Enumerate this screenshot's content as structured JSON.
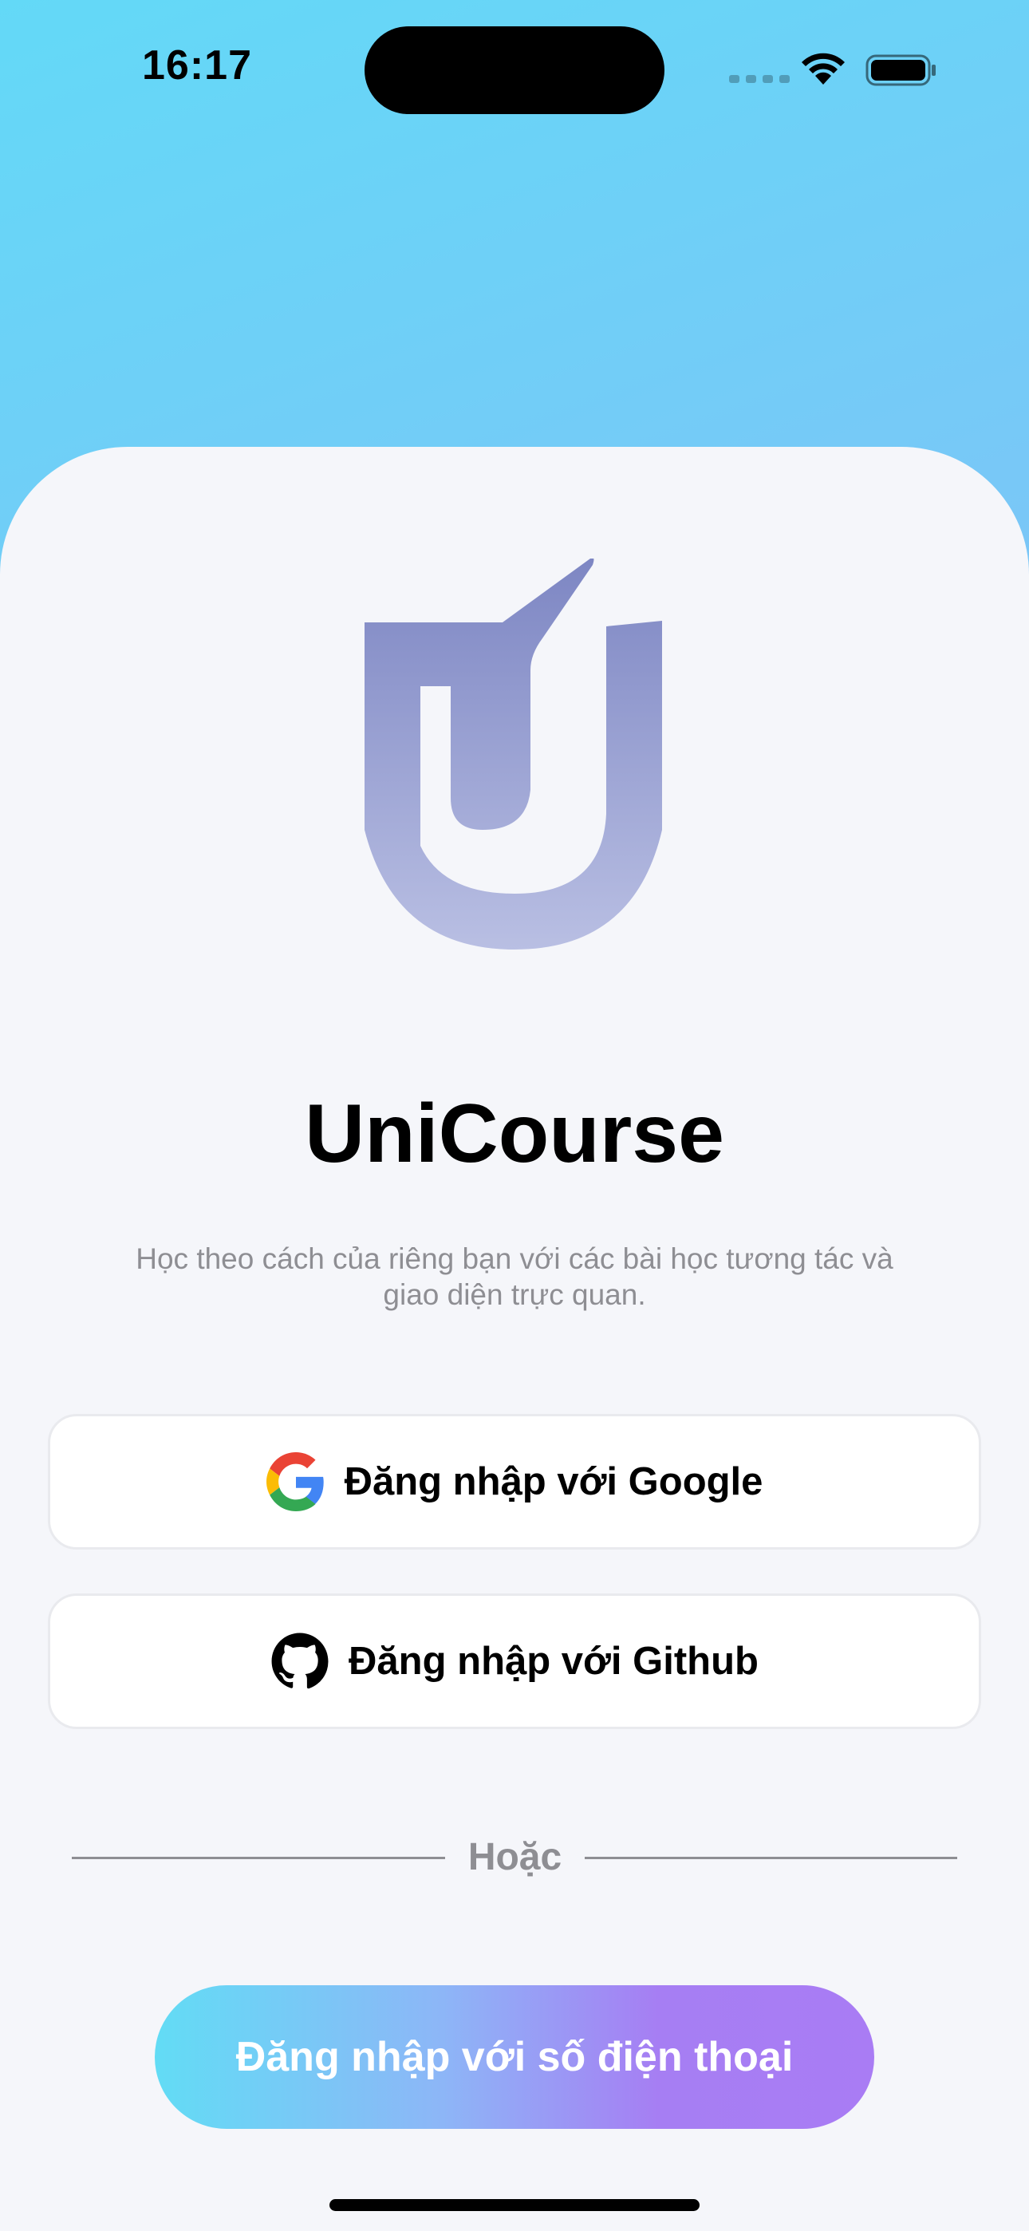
{
  "status_bar": {
    "time": "16:17"
  },
  "app": {
    "title": "UniCourse",
    "subtitle": "Học theo cách của riêng bạn với các bài học tương tác và giao diện trực quan."
  },
  "login": {
    "google_label": "Đăng nhập với Google",
    "github_label": "Đăng nhập với Github",
    "divider_text": "Hoặc",
    "phone_label": "Đăng nhập với số điện thoại"
  },
  "icons": {
    "google": "google-logo-icon",
    "github": "github-logo-icon",
    "wifi": "wifi-icon",
    "battery": "battery-icon"
  },
  "colors": {
    "gradient_start": "#63d9f7",
    "gradient_end": "#a97cf4",
    "logo": "#8089c4",
    "muted_text": "#8e8e93"
  }
}
